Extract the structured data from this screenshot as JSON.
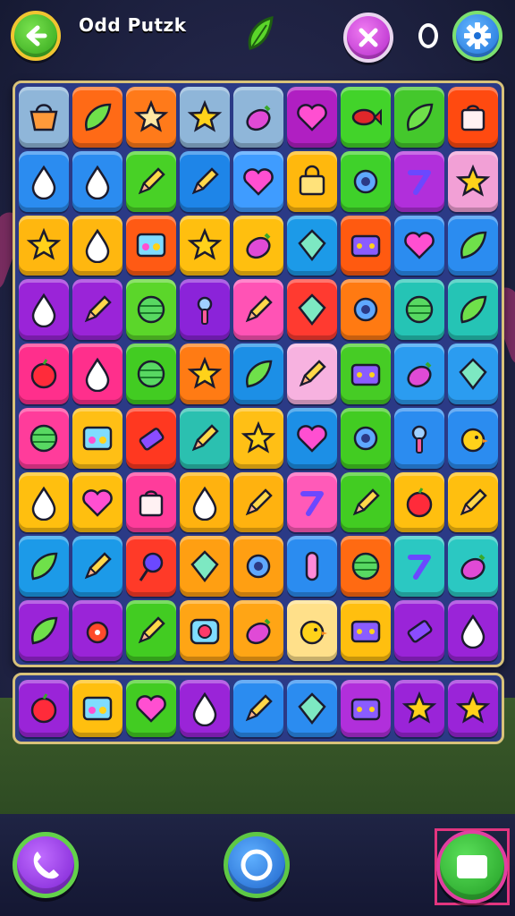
{
  "header": {
    "title": "Odd Putzk",
    "score": "",
    "buttons": {
      "back": "back-arrow-icon",
      "close": "close-x-icon",
      "settings": "gear-icon"
    }
  },
  "board": {
    "rows": [
      [
        {
          "color": "#8fb6d9",
          "icon": "basket-icon"
        },
        {
          "color": "#ff6a16",
          "icon": "leaf-icon"
        },
        {
          "color": "#ff7a1a",
          "icon": "star-blob-icon"
        },
        {
          "color": "#8fb6d9",
          "icon": "star-icon"
        },
        {
          "color": "#8fb6d9",
          "icon": "eggplant-icon"
        },
        {
          "color": "#b01fc2",
          "icon": "heart-icon"
        },
        {
          "color": "#42d32a",
          "icon": "fish-icon"
        },
        {
          "color": "#44c82c",
          "icon": "leaf-icon"
        },
        {
          "color": "#ff4a10",
          "icon": "bag-icon"
        }
      ],
      [
        {
          "color": "#2b8cf0",
          "icon": "drop-icon"
        },
        {
          "color": "#2b8cf0",
          "icon": "drop-icon"
        },
        {
          "color": "#48d126",
          "icon": "pencil-icon"
        },
        {
          "color": "#1e85e8",
          "icon": "pencil-icon"
        },
        {
          "color": "#3f9cff",
          "icon": "heart-icon"
        },
        {
          "color": "#ffb80d",
          "icon": "lock-icon"
        },
        {
          "color": "#3fd12a",
          "icon": "gear-flower-icon"
        },
        {
          "color": "#b12fdb",
          "icon": "number-icon"
        },
        {
          "color": "#f2a0d6",
          "icon": "star-icon"
        }
      ],
      [
        {
          "color": "#ffb70f",
          "icon": "star-icon"
        },
        {
          "color": "#ffb70f",
          "icon": "drop-icon"
        },
        {
          "color": "#ff5a14",
          "icon": "radio-icon"
        },
        {
          "color": "#ffbf0f",
          "icon": "star-icon"
        },
        {
          "color": "#ffbf0f",
          "icon": "eggplant-icon"
        },
        {
          "color": "#1c9ae8",
          "icon": "kite-icon"
        },
        {
          "color": "#ff5a10",
          "icon": "box-icon"
        },
        {
          "color": "#2b8cf0",
          "icon": "heart-icon"
        },
        {
          "color": "#2b8cf0",
          "icon": "leaf-icon"
        }
      ],
      [
        {
          "color": "#9a24d8",
          "icon": "drop-icon"
        },
        {
          "color": "#9a24d8",
          "icon": "pencil-icon"
        },
        {
          "color": "#5bd62a",
          "icon": "ball-icon"
        },
        {
          "color": "#8b23d9",
          "icon": "tool-icon"
        },
        {
          "color": "#ff53b5",
          "icon": "pencil-icon"
        },
        {
          "color": "#ff3a30",
          "icon": "kite-icon"
        },
        {
          "color": "#ff7a12",
          "icon": "gear-flower-icon"
        },
        {
          "color": "#25c4b5",
          "icon": "ball-icon"
        },
        {
          "color": "#25c4b5",
          "icon": "leaf-icon"
        }
      ],
      [
        {
          "color": "#ff2f8c",
          "icon": "apple-icon"
        },
        {
          "color": "#ff2f8c",
          "icon": "drop-icon"
        },
        {
          "color": "#42cc22",
          "icon": "ball-icon"
        },
        {
          "color": "#ff7b14",
          "icon": "star-icon"
        },
        {
          "color": "#1c8fe6",
          "icon": "leaf-icon"
        },
        {
          "color": "#f7b2e0",
          "icon": "pencil-icon"
        },
        {
          "color": "#46cc25",
          "icon": "box-icon"
        },
        {
          "color": "#2b9cf0",
          "icon": "eggplant-icon"
        },
        {
          "color": "#2b9cf0",
          "icon": "kite-icon"
        }
      ],
      [
        {
          "color": "#ff3c9b",
          "icon": "ball-icon"
        },
        {
          "color": "#ffbf15",
          "icon": "radio-icon"
        },
        {
          "color": "#ff3820",
          "icon": "eraser-icon"
        },
        {
          "color": "#2bc0b0",
          "icon": "pencil-icon"
        },
        {
          "color": "#ffbf15",
          "icon": "star-icon"
        },
        {
          "color": "#1c8fe6",
          "icon": "heart-icon"
        },
        {
          "color": "#42cc22",
          "icon": "gear-flower-icon"
        },
        {
          "color": "#2b8cf0",
          "icon": "tool-icon"
        },
        {
          "color": "#2b8cf0",
          "icon": "bird-icon"
        }
      ],
      [
        {
          "color": "#ffbf0f",
          "icon": "drop-icon"
        },
        {
          "color": "#ffbf0f",
          "icon": "heart-icon"
        },
        {
          "color": "#ff3c9b",
          "icon": "bag-icon"
        },
        {
          "color": "#ffb20f",
          "icon": "drop-icon"
        },
        {
          "color": "#ffb20f",
          "icon": "pencil-icon"
        },
        {
          "color": "#ff5ab8",
          "icon": "number-icon"
        },
        {
          "color": "#42cc22",
          "icon": "pencil-icon"
        },
        {
          "color": "#ffbf0f",
          "icon": "apple-icon"
        },
        {
          "color": "#ffbf0f",
          "icon": "pencil-icon"
        }
      ],
      [
        {
          "color": "#1c9ae8",
          "icon": "leaf-icon"
        },
        {
          "color": "#1c9ae8",
          "icon": "pencil-icon"
        },
        {
          "color": "#ff3a28",
          "icon": "lollipop-icon"
        },
        {
          "color": "#ff9f12",
          "icon": "kite-icon"
        },
        {
          "color": "#ff9f12",
          "icon": "gear-flower-icon"
        },
        {
          "color": "#2b8cf0",
          "icon": "pill-icon"
        },
        {
          "color": "#ff6a12",
          "icon": "ball-icon"
        },
        {
          "color": "#2bc8c2",
          "icon": "number-icon"
        },
        {
          "color": "#2bc8c2",
          "icon": "eggplant-icon"
        }
      ],
      [
        {
          "color": "#9a24d8",
          "icon": "leaf-icon"
        },
        {
          "color": "#9a24d8",
          "icon": "bug-icon"
        },
        {
          "color": "#42cc22",
          "icon": "pencil-icon"
        },
        {
          "color": "#ffa515",
          "icon": "camera-icon"
        },
        {
          "color": "#ffa515",
          "icon": "eggplant-icon"
        },
        {
          "color": "#ffe08a",
          "icon": "bird-icon"
        },
        {
          "color": "#ffbf0f",
          "icon": "box-icon"
        },
        {
          "color": "#9a24d8",
          "icon": "eraser-icon"
        },
        {
          "color": "#9a24d8",
          "icon": "drop-icon"
        }
      ]
    ]
  },
  "tray": {
    "tiles": [
      {
        "color": "#9a24d8",
        "icon": "apple-icon"
      },
      {
        "color": "#ffbf0f",
        "icon": "radio-icon"
      },
      {
        "color": "#42cc22",
        "icon": "heart-icon"
      },
      {
        "color": "#9a24d8",
        "icon": "drop-icon"
      },
      {
        "color": "#2b8cf0",
        "icon": "pencil-icon"
      },
      {
        "color": "#2b8cf0",
        "icon": "kite-icon"
      },
      {
        "color": "#b12fdb",
        "icon": "box-icon"
      },
      {
        "color": "#9a24d8",
        "icon": "star-icon"
      },
      {
        "color": "#9a24d8",
        "icon": "star-icon"
      }
    ]
  },
  "footer": {
    "buttons": {
      "left": "phone-icon",
      "center": "ring-icon",
      "right": "menu-card-icon"
    }
  },
  "colors": {
    "accent_green": "#42cc22",
    "board_blue": "#2b3a86",
    "frame_gold": "#d8c27a"
  }
}
